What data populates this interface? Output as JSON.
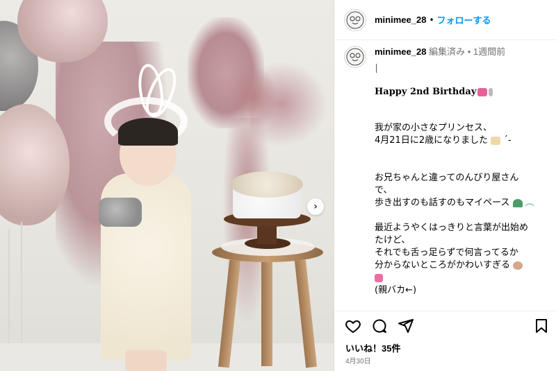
{
  "post": {
    "username": "minimee_28",
    "separator": "•",
    "follow_label": "フォローする"
  },
  "comment": {
    "username": "minimee_28",
    "edited": "編集済み",
    "dot": "•",
    "time": "1週間前"
  },
  "caption": {
    "title": "Happy 2nd Birthday",
    "lines_a": [
      "我が家の小さなプリンセス、",
      "4月21日に2歳になりました"
    ],
    "lines_b": [
      "お兄ちゃんと違ってのんびり屋さん",
      "で、",
      "歩き出すのも話すのもマイペース"
    ],
    "lines_c": [
      "最近ようやくはっきりと言葉が出始め",
      "たけど、",
      "それでも舌っ足らずで何言ってるか",
      "分からないところがかわいすぎる"
    ],
    "closing": "(親バカ←)"
  },
  "engagement": {
    "likes": "いいね！35件",
    "date": "4月30日"
  },
  "icons": {
    "like": "heart-icon",
    "comment": "comment-icon",
    "share": "share-icon",
    "save": "bookmark-icon",
    "next": "chevron-right-icon"
  },
  "colors": {
    "follow_blue": "#0095f6",
    "meta_gray": "#737373"
  }
}
